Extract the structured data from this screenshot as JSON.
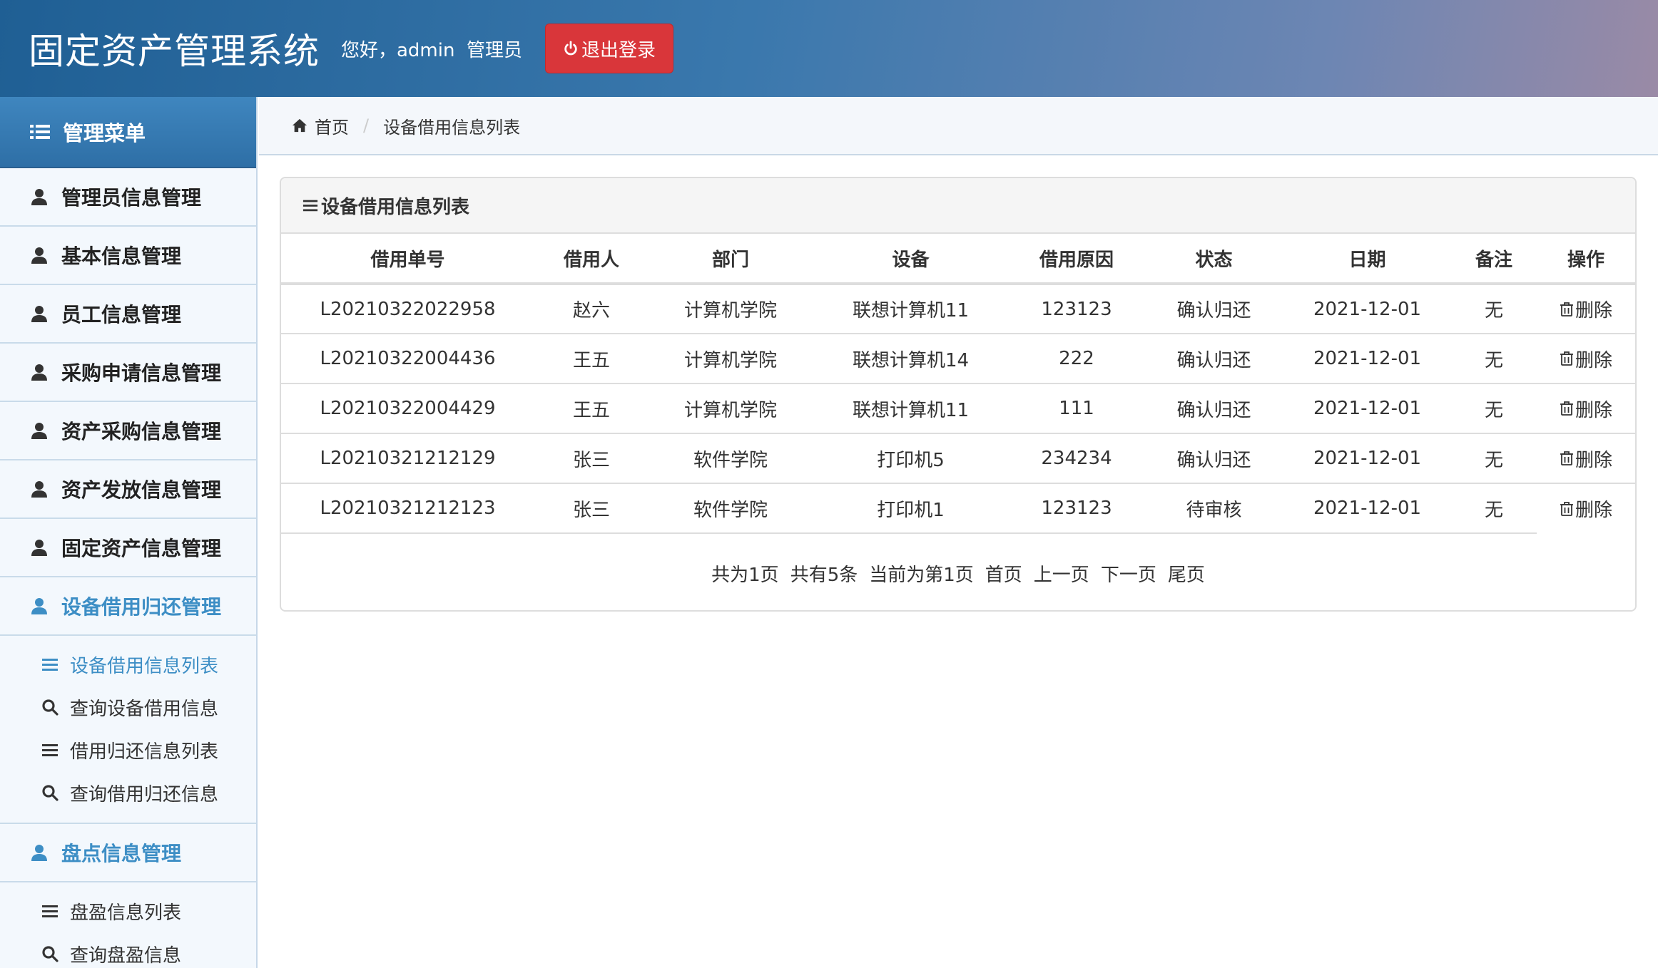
{
  "header": {
    "app_title": "固定资产管理系统",
    "greeting": "您好，admin  管理员",
    "logout_label": "退出登录"
  },
  "sidebar": {
    "title": "管理菜单",
    "items": [
      {
        "label": "管理员信息管理"
      },
      {
        "label": "基本信息管理"
      },
      {
        "label": "员工信息管理"
      },
      {
        "label": "采购申请信息管理"
      },
      {
        "label": "资产采购信息管理"
      },
      {
        "label": "资产发放信息管理"
      },
      {
        "label": "固定资产信息管理"
      },
      {
        "label": "设备借用归还管理",
        "active": true
      },
      {
        "label": "盘点信息管理"
      }
    ],
    "submenu_borrow": [
      {
        "label": "设备借用信息列表",
        "icon": "list-icon",
        "active": true
      },
      {
        "label": "查询设备借用信息",
        "icon": "search-icon"
      },
      {
        "label": "借用归还信息列表",
        "icon": "list-icon"
      },
      {
        "label": "查询借用归还信息",
        "icon": "search-icon"
      }
    ],
    "submenu_inventory": [
      {
        "label": "盘盈信息列表",
        "icon": "list-icon"
      },
      {
        "label": "查询盘盈信息",
        "icon": "search-icon"
      }
    ]
  },
  "breadcrumb": {
    "home": "首页",
    "current": "设备借用信息列表"
  },
  "panel": {
    "title": "设备借用信息列表"
  },
  "table": {
    "columns": [
      "借用单号",
      "借用人",
      "部门",
      "设备",
      "借用原因",
      "状态",
      "日期",
      "备注",
      "操作"
    ],
    "rows": [
      [
        "L20210322022958",
        "赵六",
        "计算机学院",
        "联想计算机11",
        "123123",
        "确认归还",
        "2021-12-01",
        "无",
        "删除"
      ],
      [
        "L20210322004436",
        "王五",
        "计算机学院",
        "联想计算机14",
        "222",
        "确认归还",
        "2021-12-01",
        "无",
        "删除"
      ],
      [
        "L20210322004429",
        "王五",
        "计算机学院",
        "联想计算机11",
        "111",
        "确认归还",
        "2021-12-01",
        "无",
        "删除"
      ],
      [
        "L20210321212129",
        "张三",
        "软件学院",
        "打印机5",
        "234234",
        "确认归还",
        "2021-12-01",
        "无",
        "删除"
      ],
      [
        "L20210321212123",
        "张三",
        "软件学院",
        "打印机1",
        "123123",
        "待审核",
        "2021-12-01",
        "无",
        "删除"
      ]
    ]
  },
  "pagination": {
    "total_pages": "共为1页",
    "total_records": "共有5条",
    "current_page": "当前为第1页",
    "first": "首页",
    "prev": "上一页",
    "next": "下一页",
    "last": "尾页"
  },
  "colors": {
    "accent": "#3d8ec5",
    "logout": "#d9363a",
    "header_start": "#1f5f94"
  }
}
